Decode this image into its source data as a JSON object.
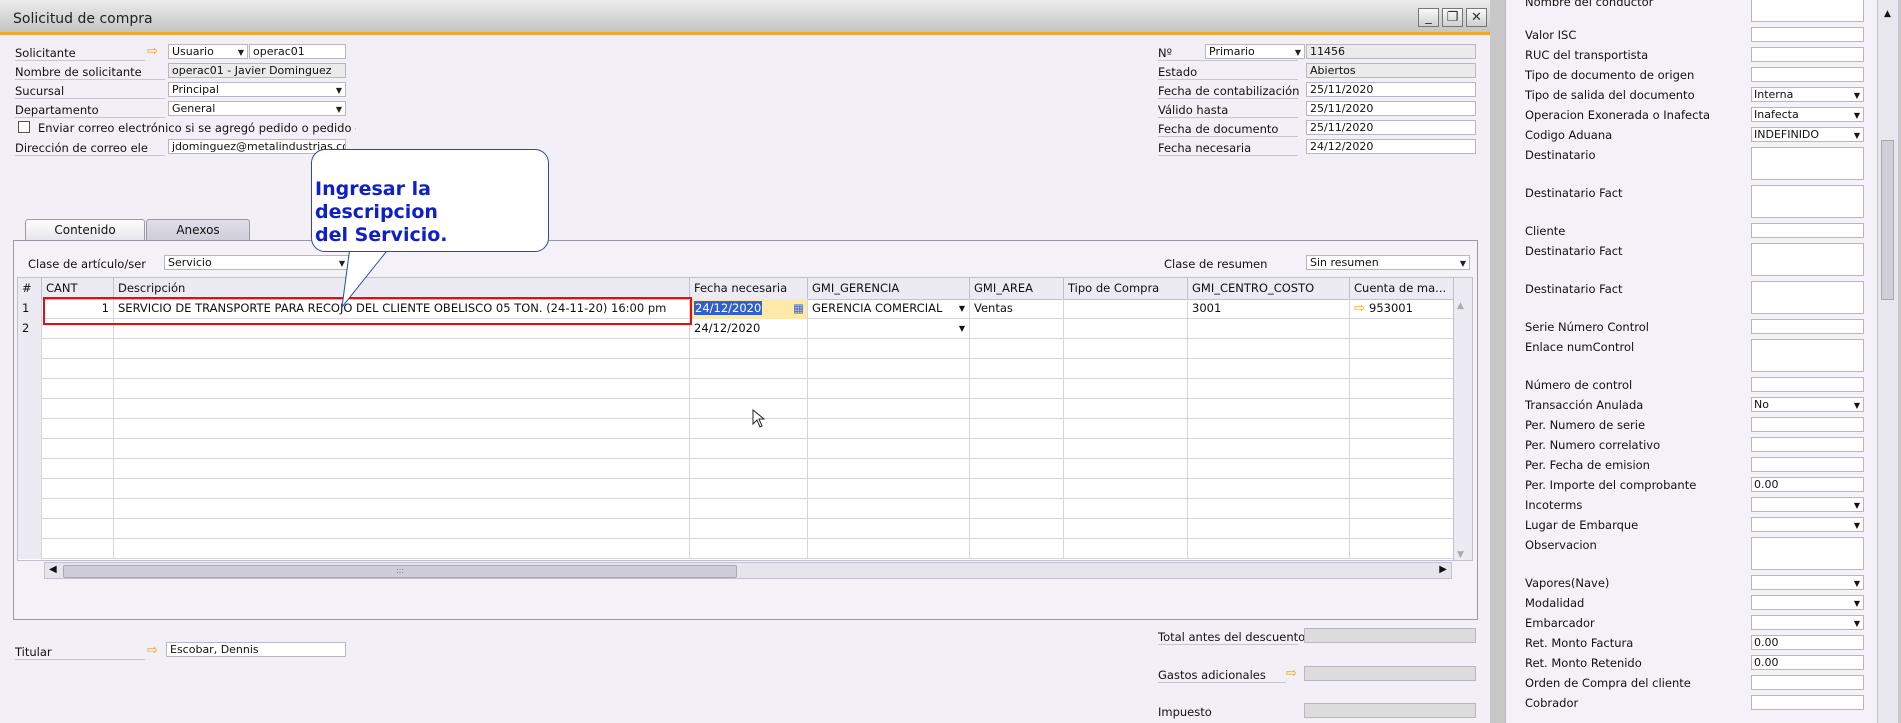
{
  "window": {
    "title": "Solicitud de compra"
  },
  "header_left": {
    "solicitante_label": "Solicitante",
    "solicitante_type": "Usuario",
    "solicitante_code": "operac01",
    "nombre_label": "Nombre de solicitante",
    "nombre_value": "operac01 - Javier Dominguez",
    "sucursal_label": "Sucursal",
    "sucursal_value": "Principal",
    "departamento_label": "Departamento",
    "departamento_value": "General",
    "enviar_label": "Enviar correo electrónico si se agregó pedido o pedido e",
    "correo_label": "Dirección de correo ele",
    "correo_value": "jdominguez@metalindustrias.co"
  },
  "header_right": {
    "no_label": "Nº",
    "no_series": "Primario",
    "no_value": "11456",
    "estado_label": "Estado",
    "estado_value": "Abiertos",
    "fecha_cont_label": "Fecha de contabilización",
    "fecha_cont_value": "25/11/2020",
    "valido_label": "Válido hasta",
    "valido_value": "25/11/2020",
    "fecha_doc_label": "Fecha de documento",
    "fecha_doc_value": "25/11/2020",
    "fecha_nec_label": "Fecha necesaria",
    "fecha_nec_value": "24/12/2020"
  },
  "tabs": {
    "contenido": "Contenido",
    "anexos": "Anexos"
  },
  "callout": {
    "line1": "Ingresar la descripcion",
    "line2": "del Servicio."
  },
  "content": {
    "clase_articulo_label": "Clase de artículo/ser",
    "clase_articulo_value": "Servicio",
    "clase_resumen_label": "Clase de resumen",
    "clase_resumen_value": "Sin resumen"
  },
  "grid": {
    "headers": [
      "#",
      "CANT",
      "Descripción",
      "Fecha necesaria",
      "GMI_GERENCIA",
      "GMI_AREA",
      "Tipo de Compra",
      "GMI_CENTRO_COSTO",
      "Cuenta de ma..."
    ],
    "rows": [
      {
        "num": "1",
        "cant": "1",
        "desc": "SERVICIO DE TRANSPORTE PARA RECOJO DEL CLIENTE OBELISCO 05 TON. (24-11-20) 16:00 pm",
        "fecha": "24/12/2020",
        "gerencia": "GERENCIA COMERCIAL",
        "area": "Ventas",
        "tipo": "",
        "centro": "3001",
        "cuenta": "953001"
      },
      {
        "num": "2",
        "cant": "",
        "desc": "",
        "fecha": "24/12/2020",
        "gerencia": "",
        "area": "",
        "tipo": "",
        "centro": "",
        "cuenta": ""
      }
    ],
    "scroll_grip": ":::"
  },
  "footer": {
    "titular_label": "Titular",
    "titular_value": "Escobar, Dennis",
    "total_label": "Total antes del descuento",
    "gastos_label": "Gastos adicionales",
    "impuesto_label": "Impuesto"
  },
  "right_panel": [
    {
      "label": "Nombre del conductor",
      "value": "",
      "type": "text",
      "h": 28
    },
    {
      "label": "Valor ISC",
      "value": "",
      "type": "text",
      "h": 15
    },
    {
      "label": "RUC del transportista",
      "value": "",
      "type": "text",
      "h": 15
    },
    {
      "label": "Tipo de documento de origen",
      "value": "",
      "type": "text",
      "h": 15
    },
    {
      "label": "Tipo de salida del documento",
      "value": "Interna",
      "type": "dd",
      "h": 15
    },
    {
      "label": "Operacion Exonerada o Inafecta",
      "value": "Inafecta",
      "type": "dd",
      "h": 15
    },
    {
      "label": "Codigo Aduana",
      "value": "INDEFINIDO",
      "type": "dd",
      "h": 15
    },
    {
      "label": "Destinatario",
      "value": "",
      "type": "text",
      "h": 33
    },
    {
      "label": "Destinatario Fact",
      "value": "",
      "type": "text",
      "h": 33
    },
    {
      "label": "Cliente",
      "value": "",
      "type": "text",
      "h": 15
    },
    {
      "label": "Destinatario Fact",
      "value": "",
      "type": "text",
      "h": 33
    },
    {
      "label": "Destinatario Fact",
      "value": "",
      "type": "text",
      "h": 33
    },
    {
      "label": "Serie Número Control",
      "value": "",
      "type": "text",
      "h": 15
    },
    {
      "label": "Enlace numControl",
      "value": "",
      "type": "text",
      "h": 33
    },
    {
      "label": "Número de control",
      "value": "",
      "type": "text",
      "h": 15
    },
    {
      "label": "Transacción Anulada",
      "value": "No",
      "type": "dd",
      "h": 15
    },
    {
      "label": "Per. Numero de serie",
      "value": "",
      "type": "text",
      "h": 15
    },
    {
      "label": "Per. Numero correlativo",
      "value": "",
      "type": "text",
      "h": 15
    },
    {
      "label": "Per. Fecha de emision",
      "value": "",
      "type": "text",
      "h": 15
    },
    {
      "label": "Per. Importe del comprobante",
      "value": "0.00",
      "type": "text",
      "h": 15
    },
    {
      "label": "Incoterms",
      "value": "",
      "type": "dd",
      "h": 15
    },
    {
      "label": "Lugar de Embarque",
      "value": "",
      "type": "dd",
      "h": 15
    },
    {
      "label": "Observacion",
      "value": "",
      "type": "text",
      "h": 33
    },
    {
      "label": "Vapores(Nave)",
      "value": "",
      "type": "dd",
      "h": 15
    },
    {
      "label": "Modalidad",
      "value": "",
      "type": "dd",
      "h": 15
    },
    {
      "label": "Embarcador",
      "value": "",
      "type": "dd",
      "h": 15
    },
    {
      "label": "Ret. Monto Factura",
      "value": "0.00",
      "type": "text",
      "h": 15
    },
    {
      "label": "Ret. Monto Retenido",
      "value": "0.00",
      "type": "text",
      "h": 15
    },
    {
      "label": "Orden de Compra del cliente",
      "value": "",
      "type": "text",
      "h": 15
    },
    {
      "label": "Cobrador",
      "value": "",
      "type": "text",
      "h": 15
    }
  ]
}
